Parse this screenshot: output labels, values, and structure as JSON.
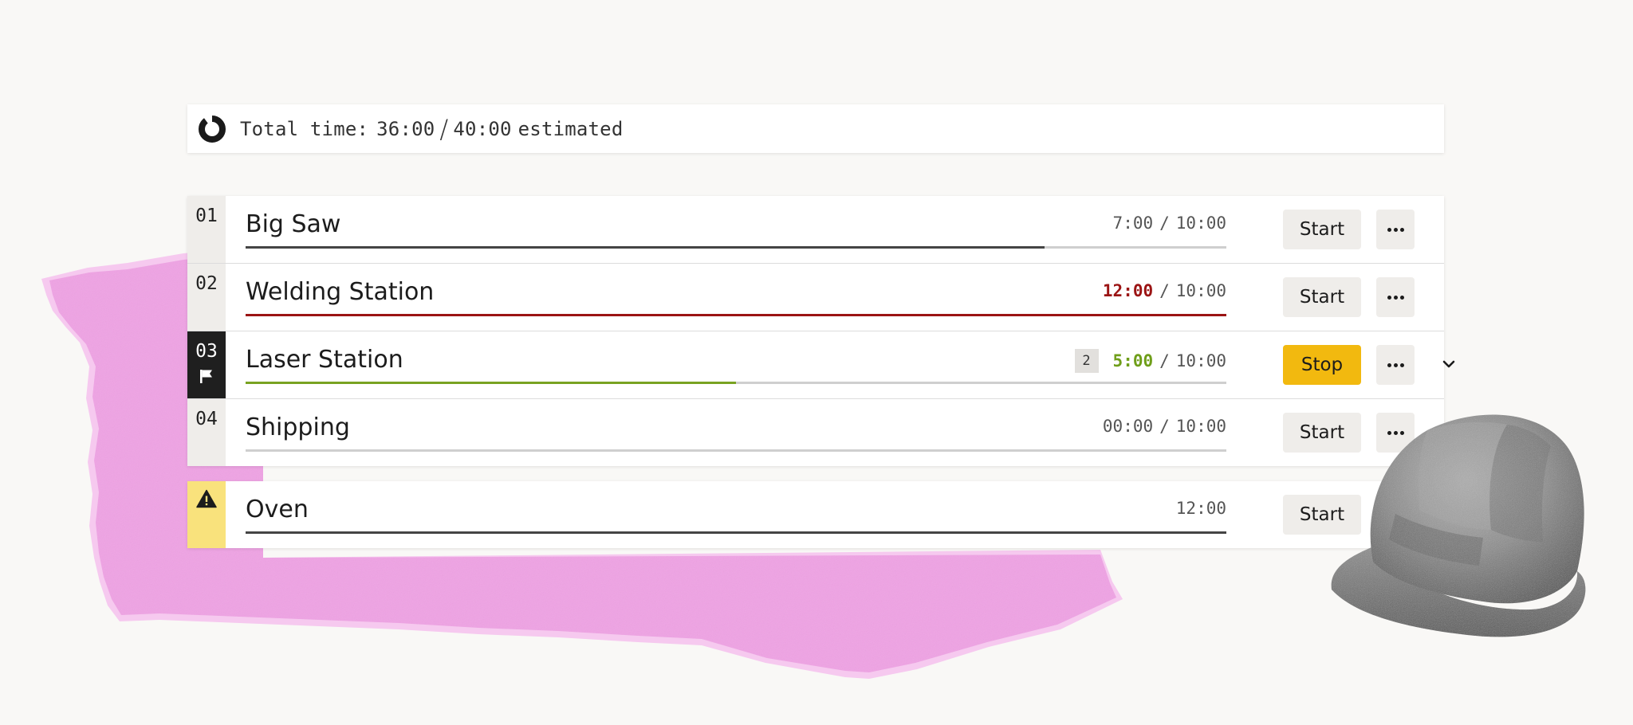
{
  "total": {
    "label": "Total time:",
    "elapsed": "36:00",
    "estimate": "40:00",
    "suffix": "estimated",
    "progress": 0.9
  },
  "tasks": [
    {
      "number": "01",
      "name": "Big Saw",
      "elapsed": "7:00",
      "separator": "/",
      "estimate": "10:00",
      "progress": 0.815,
      "state": "idle",
      "action": "Start"
    },
    {
      "number": "02",
      "name": "Welding Station",
      "elapsed": "12:00",
      "separator": "/",
      "estimate": "10:00",
      "progress": 1.0,
      "state": "over",
      "action": "Start"
    },
    {
      "number": "03",
      "name": "Laser Station",
      "badge": "2",
      "elapsed": "5:00",
      "separator": "/",
      "estimate": "10:00",
      "progress": 0.5,
      "state": "running",
      "action": "Stop"
    },
    {
      "number": "04",
      "name": "Shipping",
      "elapsed": "00:00",
      "separator": "/",
      "estimate": "10:00",
      "progress": 0.0,
      "state": "idle",
      "action": "Start"
    }
  ],
  "unscheduled": {
    "name": "Oven",
    "elapsed": "12:00",
    "progress": 1.0,
    "action": "Start"
  },
  "colors": {
    "over": "#9b1414",
    "running": "#79a321",
    "stop_button": "#f2b90f",
    "warning": "#f9e27c",
    "decorative_paper": "#f0a6e6"
  },
  "icons": {
    "total": "donut-progress-icon",
    "active_task": "flag-icon",
    "warning": "warning-triangle-icon",
    "more": "more-dots-icon",
    "expand": "chevron-down-icon"
  }
}
